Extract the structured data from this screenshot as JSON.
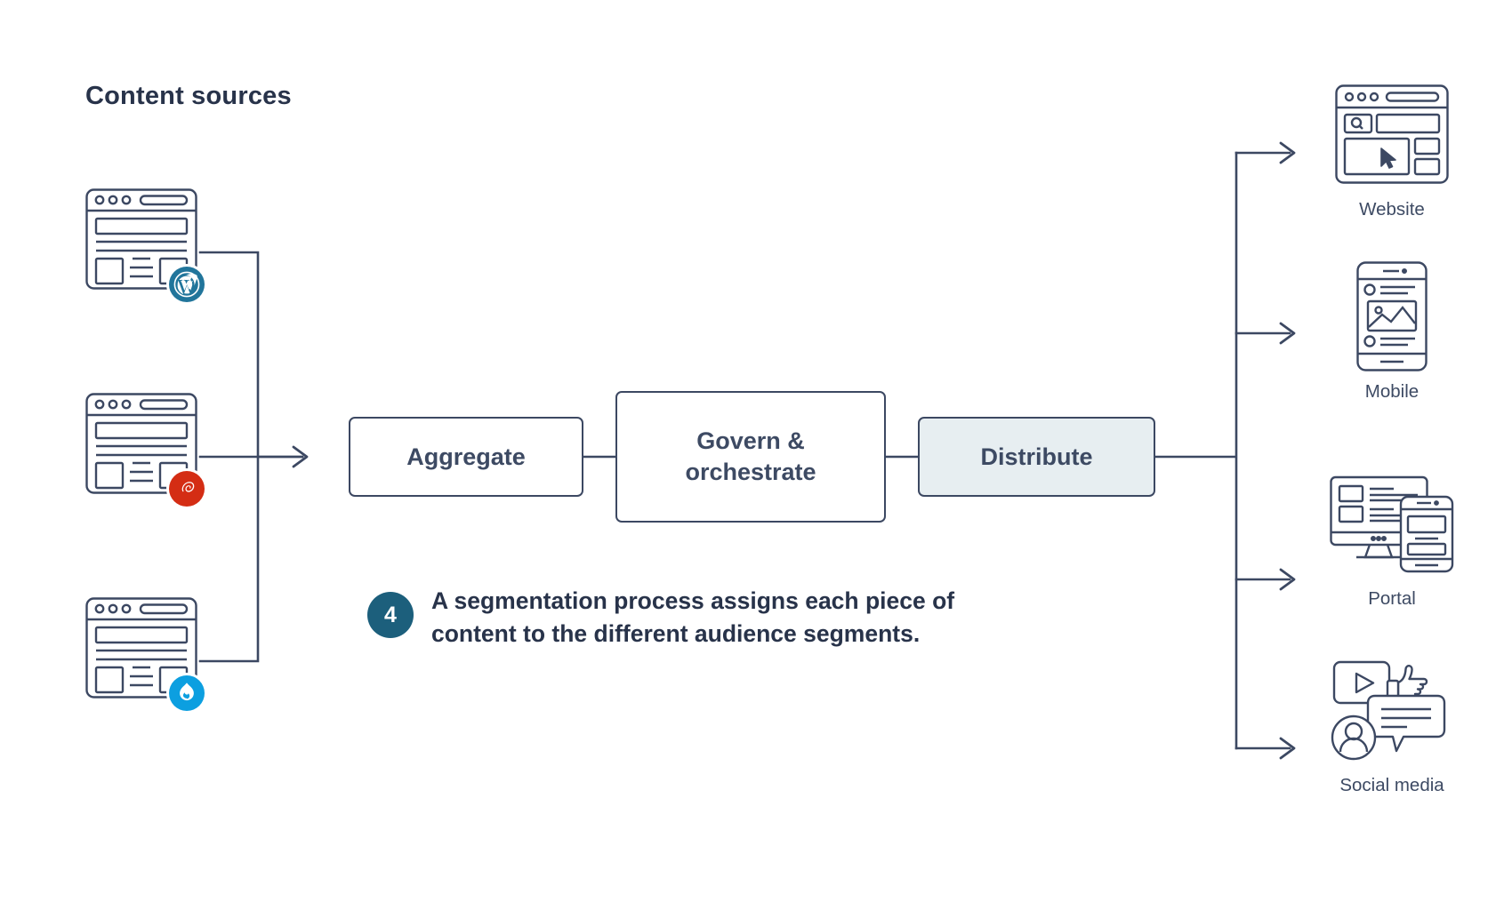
{
  "title": "Content sources",
  "colors": {
    "ink": "#3c4862",
    "title_ink": "#28334a",
    "teal": "#1c5f7c",
    "wordpress_blue": "#21759b",
    "ruby_red": "#d42d14",
    "drupal_blue": "#0c9fe0",
    "distribute_fill": "#e7eef1",
    "background": "#ffffff"
  },
  "sources": [
    {
      "name": "wordpress",
      "icon": "browser-window-icon",
      "badge": "wordpress-logo-icon"
    },
    {
      "name": "ruby",
      "icon": "browser-window-icon",
      "badge": "ruby-logo-icon"
    },
    {
      "name": "drupal",
      "icon": "browser-window-icon",
      "badge": "drupal-logo-icon"
    }
  ],
  "process": [
    {
      "id": "aggregate",
      "label": "Aggregate",
      "highlighted": false
    },
    {
      "id": "govern-orchestrate",
      "label": "Govern &\norchestrate",
      "line1": "Govern &",
      "line2": "orchestrate",
      "highlighted": false
    },
    {
      "id": "distribute",
      "label": "Distribute",
      "highlighted": true
    }
  ],
  "annotation": {
    "step_number": "4",
    "line1": "A segmentation process assigns each piece of",
    "line2": "content to the different audience segments.",
    "text": "A segmentation process assigns each piece of content to the different audience segments."
  },
  "outputs": [
    {
      "id": "website",
      "label": "Website",
      "icon": "browser-search-window-icon"
    },
    {
      "id": "mobile",
      "label": "Mobile",
      "icon": "smartphone-icon"
    },
    {
      "id": "portal",
      "label": "Portal",
      "icon": "desktop-and-phone-icon"
    },
    {
      "id": "social-media",
      "label": "Social media",
      "icon": "social-media-icon"
    }
  ]
}
